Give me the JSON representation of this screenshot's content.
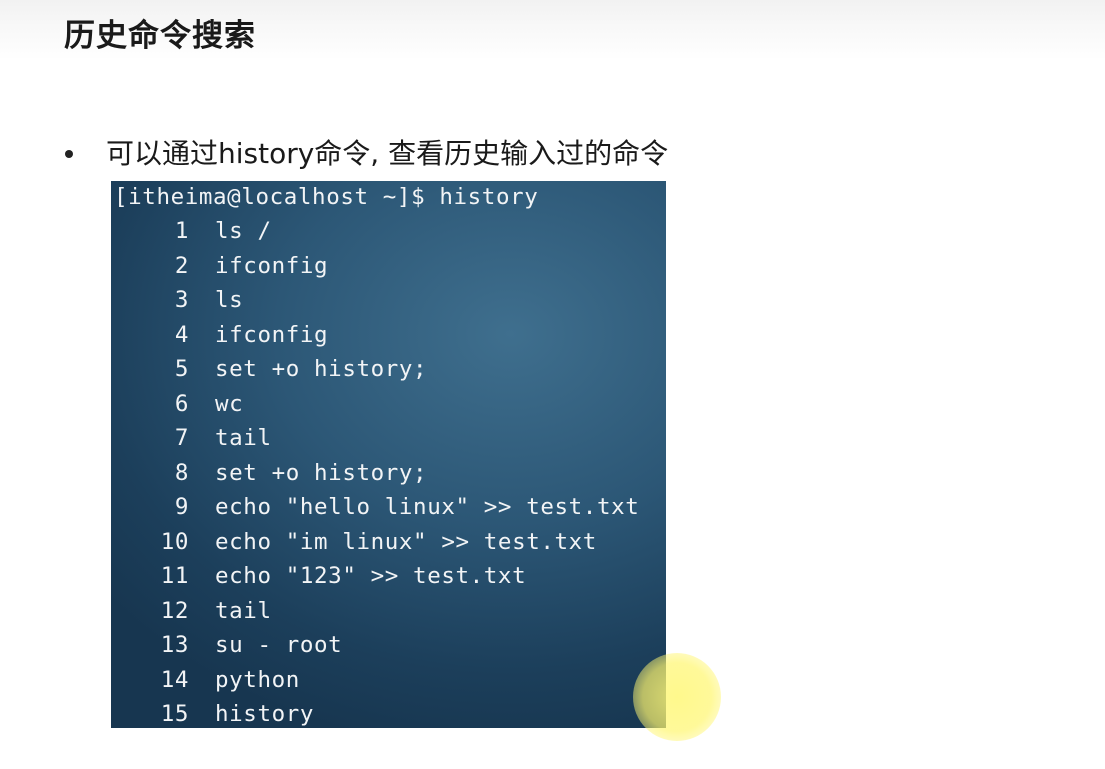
{
  "slide": {
    "title": "历史命令搜索",
    "bullet": "可以通过history命令, 查看历史输入过的命令"
  },
  "terminal": {
    "prompt": "[itheima@localhost ~]$ history",
    "history": [
      {
        "num": "1",
        "cmd": "ls /"
      },
      {
        "num": "2",
        "cmd": "ifconfig"
      },
      {
        "num": "3",
        "cmd": "ls"
      },
      {
        "num": "4",
        "cmd": "ifconfig"
      },
      {
        "num": "5",
        "cmd": "set +o history;"
      },
      {
        "num": "6",
        "cmd": "wc"
      },
      {
        "num": "7",
        "cmd": "tail"
      },
      {
        "num": "8",
        "cmd": "set +o history;"
      },
      {
        "num": "9",
        "cmd": "echo \"hello linux\" >> test.txt"
      },
      {
        "num": "10",
        "cmd": "echo \"im linux\" >> test.txt"
      },
      {
        "num": "11",
        "cmd": "echo \"123\" >> test.txt"
      },
      {
        "num": "12",
        "cmd": "tail"
      },
      {
        "num": "13",
        "cmd": "su - root"
      },
      {
        "num": "14",
        "cmd": "python"
      },
      {
        "num": "15",
        "cmd": "history"
      }
    ]
  },
  "colors": {
    "terminal_bg": "#2c5776",
    "terminal_text": "#f2f4f6",
    "pointer_highlight": "#fff66e"
  }
}
